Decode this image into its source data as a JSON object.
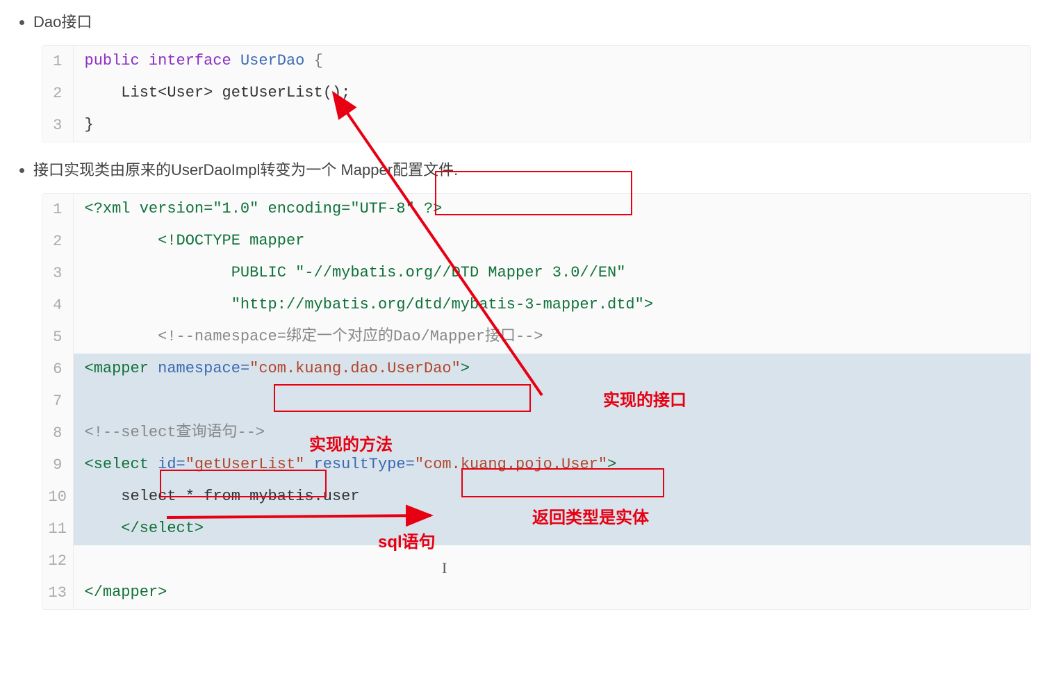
{
  "bullet1": "Dao接口",
  "code1": {
    "l1_kw1": "public",
    "l1_kw2": "interface",
    "l1_cls": "UserDao",
    "l1_brace": " {",
    "l2": "    List<User> getUserList();",
    "l3": "}"
  },
  "bullet2_a": "接口实现类由原来的UserDaoImpl转变为一个 ",
  "bullet2_b": "Mapper配置文件.",
  "code2": {
    "l1": "<?xml version=\"1.0\" encoding=\"UTF-8\" ?>",
    "l2": "        <!DOCTYPE mapper",
    "l3": "                PUBLIC \"-//mybatis.org//DTD Mapper 3.0//EN\"",
    "l4": "                \"http://mybatis.org/dtd/mybatis-3-mapper.dtd\">",
    "l5": "        <!--namespace=绑定一个对应的Dao/Mapper接口-->",
    "l6_a": "<mapper",
    "l6_b": " namespace=",
    "l6_c": "\"com.kuang.dao.UserDao\"",
    "l6_d": ">",
    "l7": "",
    "l8": "<!--select查询语句-->",
    "l9_a": "<select",
    "l9_b": " id=",
    "l9_c": "\"getUserList\"",
    "l9_d": " resultType=",
    "l9_e": "\"com.kuang.pojo.User\"",
    "l9_f": ">",
    "l10": "    select * from mybatis.user",
    "l11": "    </select>",
    "l12": "",
    "l13": "</mapper>"
  },
  "annotations": {
    "impl_interface": "实现的接口",
    "impl_method": "实现的方法",
    "sql_stmt": "sql语句",
    "return_entity": "返回类型是实体"
  }
}
